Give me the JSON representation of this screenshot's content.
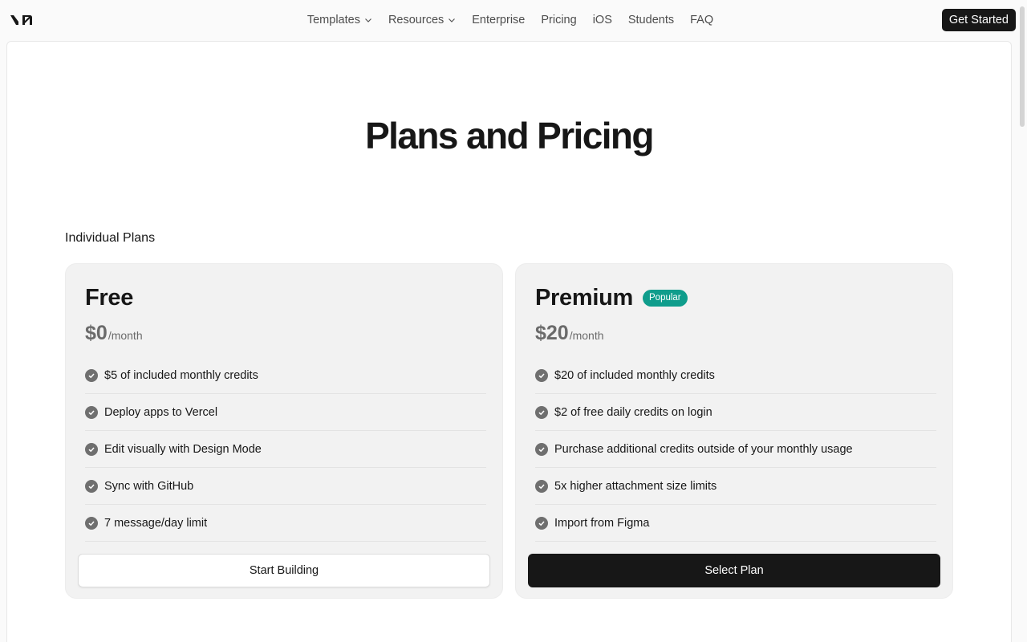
{
  "header": {
    "logo_name": "v0-logo",
    "nav": [
      {
        "label": "Templates",
        "has_dropdown": true
      },
      {
        "label": "Resources",
        "has_dropdown": true
      },
      {
        "label": "Enterprise",
        "has_dropdown": false
      },
      {
        "label": "Pricing",
        "has_dropdown": false
      },
      {
        "label": "iOS",
        "has_dropdown": false
      },
      {
        "label": "Students",
        "has_dropdown": false
      },
      {
        "label": "FAQ",
        "has_dropdown": false
      }
    ],
    "cta_label": "Get Started"
  },
  "main": {
    "title": "Plans and Pricing",
    "section_label": "Individual Plans",
    "plans": [
      {
        "name": "Free",
        "price": "$0",
        "period": "/month",
        "features": [
          "$5 of included monthly credits",
          "Deploy apps to Vercel",
          "Edit visually with Design Mode",
          "Sync with GitHub",
          "7 message/day limit"
        ],
        "button_label": "Start Building"
      },
      {
        "name": "Premium",
        "badge": "Popular",
        "price": "$20",
        "period": "/month",
        "features": [
          "$20 of included monthly credits",
          "$2 of free daily credits on login",
          "Purchase additional credits outside of your monthly usage",
          "5x higher attachment size limits",
          "Import from Figma"
        ],
        "button_label": "Select Plan"
      }
    ]
  },
  "colors": {
    "accent_badge": "#0f9d8c",
    "primary_button": "#171717",
    "card_background": "#f2f2f2"
  }
}
